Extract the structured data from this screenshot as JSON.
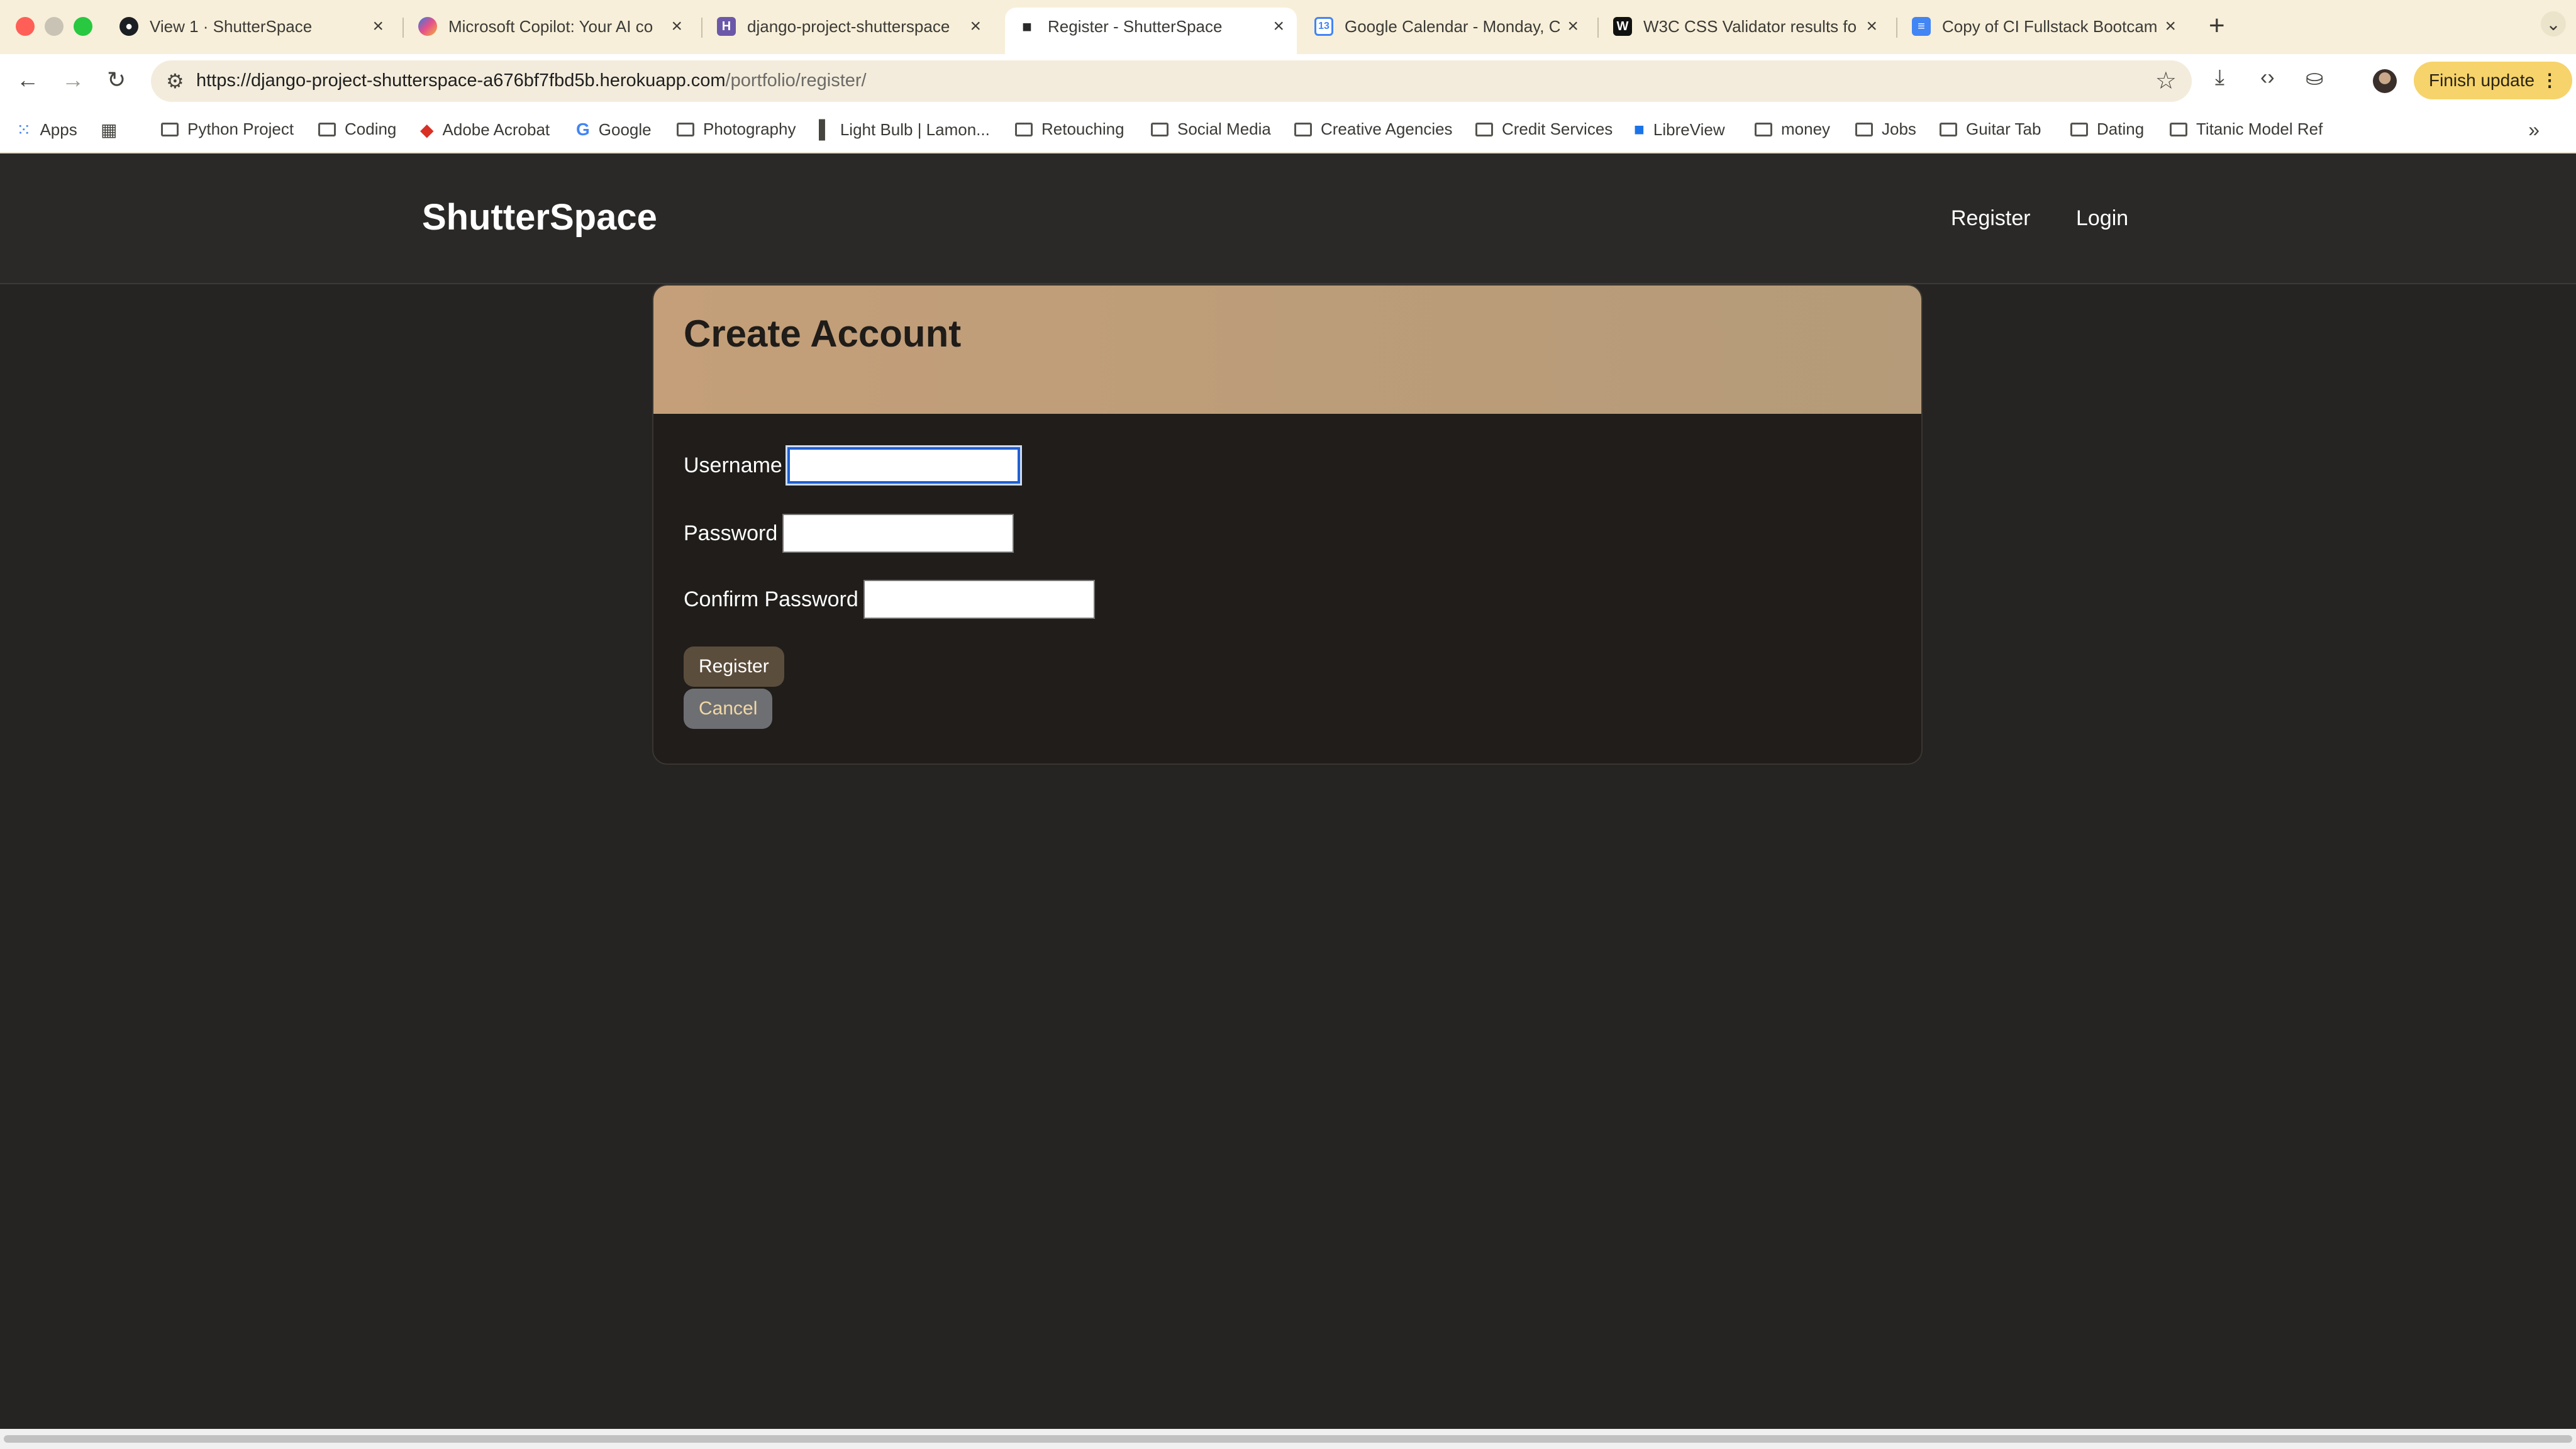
{
  "browser": {
    "tabs": [
      {
        "label": "View 1 · ShutterSpace",
        "icon": "github-icon",
        "active": false
      },
      {
        "label": "Microsoft Copilot: Your AI co",
        "icon": "copilot-icon",
        "active": false
      },
      {
        "label": "django-project-shutterspace",
        "icon": "heroku-icon",
        "active": false
      },
      {
        "label": "Register - ShutterSpace",
        "icon": "camera-icon",
        "active": true
      },
      {
        "label": "Google Calendar - Monday, C",
        "icon": "calendar-icon",
        "active": false
      },
      {
        "label": "W3C CSS Validator results fo",
        "icon": "w3c-icon",
        "active": false
      },
      {
        "label": "Copy of CI Fullstack Bootcam",
        "icon": "docs-icon",
        "active": false
      }
    ],
    "url_main": "https://django-project-shutterspace-a676bf7fbd5b.herokuapp.com",
    "url_path": "/portfolio/register/",
    "finish_update": "Finish update",
    "bookmarks": [
      {
        "label": "Apps",
        "icon": "apps-grid-icon"
      },
      {
        "label": "",
        "icon": "tab-groups-icon"
      },
      {
        "label": "Python Project",
        "icon": "folder-icon"
      },
      {
        "label": "Coding",
        "icon": "folder-icon"
      },
      {
        "label": "Adobe Acrobat",
        "icon": "acrobat-icon"
      },
      {
        "label": "Google",
        "icon": "google-icon"
      },
      {
        "label": "Photography",
        "icon": "folder-icon"
      },
      {
        "label": "Light Bulb | Lamon...",
        "icon": "bookmark-page-icon"
      },
      {
        "label": "Retouching",
        "icon": "folder-icon"
      },
      {
        "label": "Social Media",
        "icon": "folder-icon"
      },
      {
        "label": "Creative Agencies",
        "icon": "folder-icon"
      },
      {
        "label": "Credit Services",
        "icon": "folder-icon"
      },
      {
        "label": "LibreView",
        "icon": "libreview-icon"
      },
      {
        "label": "money",
        "icon": "folder-icon"
      },
      {
        "label": "Jobs",
        "icon": "folder-icon"
      },
      {
        "label": "Guitar Tab",
        "icon": "folder-icon"
      },
      {
        "label": "Dating",
        "icon": "folder-icon"
      },
      {
        "label": "Titanic Model Ref",
        "icon": "folder-icon"
      }
    ]
  },
  "site": {
    "brand": "ShutterSpace",
    "nav": {
      "register": "Register",
      "login": "Login"
    }
  },
  "form": {
    "title": "Create Account",
    "fields": [
      {
        "label": "Username",
        "value": "",
        "focused": true
      },
      {
        "label": "Password",
        "value": "",
        "focused": false
      },
      {
        "label": "Confirm Password",
        "value": "",
        "focused": false
      }
    ],
    "register_button": "Register",
    "cancel_button": "Cancel"
  },
  "colors": {
    "page_bg": "#252423",
    "card_header": "#c49f79",
    "register_btn": "#5b4d3c",
    "cancel_btn": "#6e6f73"
  }
}
